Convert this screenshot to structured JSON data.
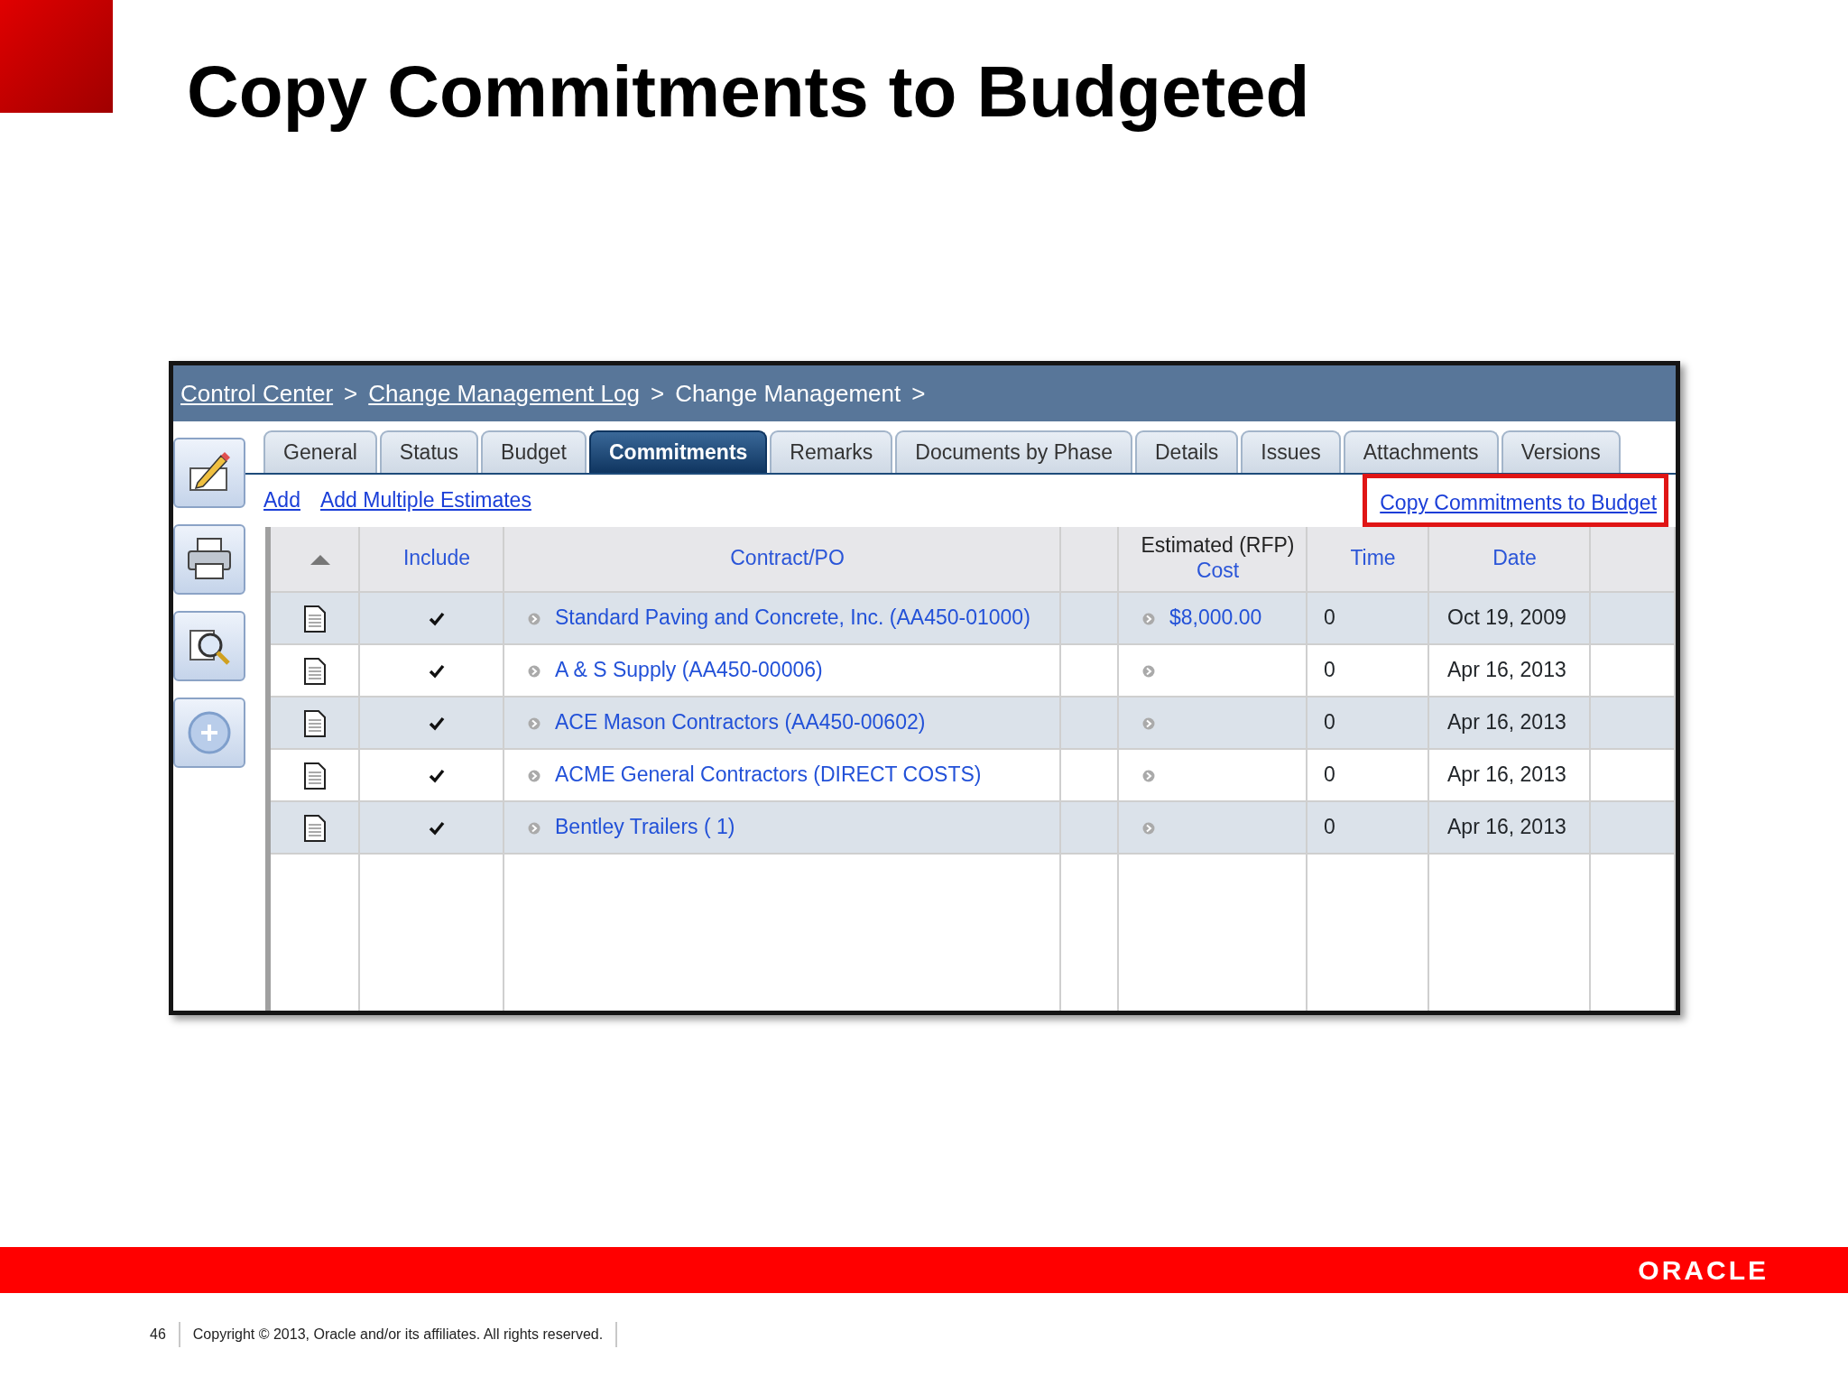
{
  "slide": {
    "title": "Copy Commitments to Budgeted"
  },
  "breadcrumb": [
    {
      "label": "Control Center",
      "link": true,
      "separator": ">"
    },
    {
      "label": "Change Management Log",
      "link": true,
      "separator": ">"
    },
    {
      "label": "Change Management",
      "link": false,
      "separator": ">"
    }
  ],
  "toolbar": [
    {
      "kind": "edit"
    },
    {
      "kind": "print"
    },
    {
      "kind": "preview"
    },
    {
      "kind": "add"
    }
  ],
  "tabs": [
    {
      "label": "General",
      "selected": false
    },
    {
      "label": "Status",
      "selected": false
    },
    {
      "label": "Budget",
      "selected": false
    },
    {
      "label": "Commitments",
      "selected": true
    },
    {
      "label": "Remarks",
      "selected": false
    },
    {
      "label": "Documents by Phase",
      "selected": false
    },
    {
      "label": "Details",
      "selected": false
    },
    {
      "label": "Issues",
      "selected": false
    },
    {
      "label": "Attachments",
      "selected": false
    },
    {
      "label": "Versions",
      "selected": false
    }
  ],
  "actions": [
    {
      "label": "Add",
      "highlighted": false
    },
    {
      "label": "Add Multiple Estimates",
      "highlighted": false
    },
    {
      "label": "Copy Commitments to Budget",
      "highlighted": true
    }
  ],
  "table": {
    "columns": [
      {
        "kind": "sort"
      },
      {
        "kind": "label",
        "label": "Include"
      },
      {
        "kind": "label",
        "label": "Contract/PO"
      },
      {
        "kind": "blank"
      },
      {
        "kind": "label",
        "caption": "Estimated (RFP)",
        "label": "Cost"
      },
      {
        "kind": "label",
        "label": "Time"
      },
      {
        "kind": "label",
        "label": "Date"
      },
      {
        "kind": "blank"
      }
    ],
    "rows": [
      {
        "include": true,
        "contract": "Standard Paving and Concrete, Inc. (AA450-01000)",
        "cost": "$8,000.00",
        "time": "0",
        "date": "Oct 19, 2009"
      },
      {
        "include": true,
        "contract": "A & S Supply (AA450-00006)",
        "time": "0",
        "date": "Apr 16, 2013"
      },
      {
        "include": true,
        "contract": "ACE Mason Contractors (AA450-00602)",
        "time": "0",
        "date": "Apr 16, 2013"
      },
      {
        "include": true,
        "contract": "ACME General Contractors (DIRECT COSTS)",
        "time": "0",
        "date": "Apr 16, 2013"
      },
      {
        "include": true,
        "contract": "Bentley Trailers ( 1)",
        "time": "0",
        "date": "Apr 16, 2013"
      }
    ]
  },
  "footer": {
    "logo": "ORACLE",
    "page": "46",
    "copyright": "Copyright © 2013, Oracle and/or its affiliates. All rights reserved."
  }
}
